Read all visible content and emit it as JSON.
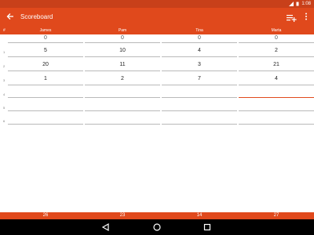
{
  "status_bar": {
    "time": "1:08",
    "icons": [
      "wifi-icon",
      "battery-icon"
    ]
  },
  "app_bar": {
    "title": "Scoreboard",
    "back_icon": "arrow-back-icon",
    "add_icon": "playlist-add-icon",
    "menu_icon": "more-vert-icon"
  },
  "table": {
    "hash_label": "#",
    "players": [
      "James",
      "Pam",
      "Tina",
      "Marta"
    ],
    "rows": [
      {
        "number": "",
        "scores": [
          "0",
          "0",
          "0",
          "0"
        ]
      },
      {
        "number": "1",
        "scores": [
          "5",
          "10",
          "4",
          "2"
        ]
      },
      {
        "number": "2",
        "scores": [
          "20",
          "11",
          "3",
          "21"
        ]
      },
      {
        "number": "3",
        "scores": [
          "1",
          "2",
          "7",
          "4"
        ]
      },
      {
        "number": "4",
        "scores": [
          "",
          "",
          "",
          ""
        ]
      },
      {
        "number": "5",
        "scores": [
          "",
          "",
          "",
          ""
        ]
      },
      {
        "number": "6",
        "scores": [
          "",
          "",
          "",
          ""
        ]
      }
    ],
    "totals": [
      "26",
      "23",
      "14",
      "27"
    ]
  },
  "nav_bar": {
    "icons": [
      "back-triangle-icon",
      "home-circle-icon",
      "recents-square-icon"
    ]
  },
  "colors": {
    "primary": "#e0491c",
    "primary_dark": "#c8401a",
    "active_underline": "#e0491c"
  }
}
